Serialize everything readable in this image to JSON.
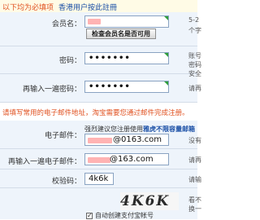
{
  "header": {
    "required_note": "以下均为必填项",
    "hk_link": "香港用户按此註冊"
  },
  "account": {
    "member_label": "会员名：",
    "check_button": "检查会员名是否可用",
    "password_label": "密码：",
    "password_value": "•••••••",
    "confirm_label": "再输入一遍密码：",
    "confirm_value": "•••••••",
    "side_texts": [
      "5-2",
      "个字",
      "账号",
      "密码",
      "安全",
      "请再"
    ]
  },
  "email_section": {
    "notice": "请填写常用的电子邮件地址，淘宝需要您通过邮件完成注册。",
    "email_label": "电子邮件：",
    "email_hint_prefix": "强烈建议您注册使用",
    "email_hint_link": "雅虎不限容量邮箱",
    "email_value": "@0163.com",
    "email_confirm_label": "再输入一遍电子邮件：",
    "email_confirm_value": "@163.com",
    "captcha_label": "校验码：",
    "captcha_input": "4k6k",
    "captcha_image_text": "4K6K",
    "auto_create_label": "自动创建支付宝帐号",
    "auto_create_checked": "✓",
    "side_texts": [
      "没有",
      "请再",
      "请输",
      "看不",
      "换一"
    ]
  }
}
